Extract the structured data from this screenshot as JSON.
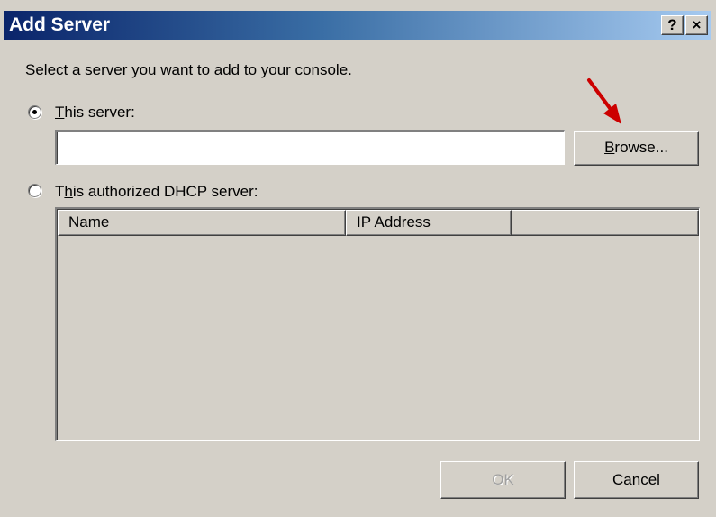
{
  "window": {
    "title": "Add Server",
    "help_label": "?",
    "close_label": "×"
  },
  "instruction": "Select a server you want to add to your console.",
  "option_this_server": {
    "label_access_key": "T",
    "label_rest": "his server:",
    "selected": true
  },
  "server_field": {
    "value": "",
    "placeholder": ""
  },
  "browse_button": {
    "label_access_key": "B",
    "label_rest": "rowse..."
  },
  "option_authorized": {
    "label_prefix": "T",
    "label_access_key": "h",
    "label_rest": "is authorized DHCP server:",
    "selected": false
  },
  "server_list": {
    "columns": [
      "Name",
      "IP Address",
      ""
    ],
    "rows": []
  },
  "buttons": {
    "ok": "OK",
    "cancel": "Cancel"
  },
  "colors": {
    "dialog_bg": "#d4d0c8",
    "title_gradient_start": "#0a246a",
    "title_gradient_end": "#a6caf0",
    "annotation_arrow": "#cc0000"
  }
}
